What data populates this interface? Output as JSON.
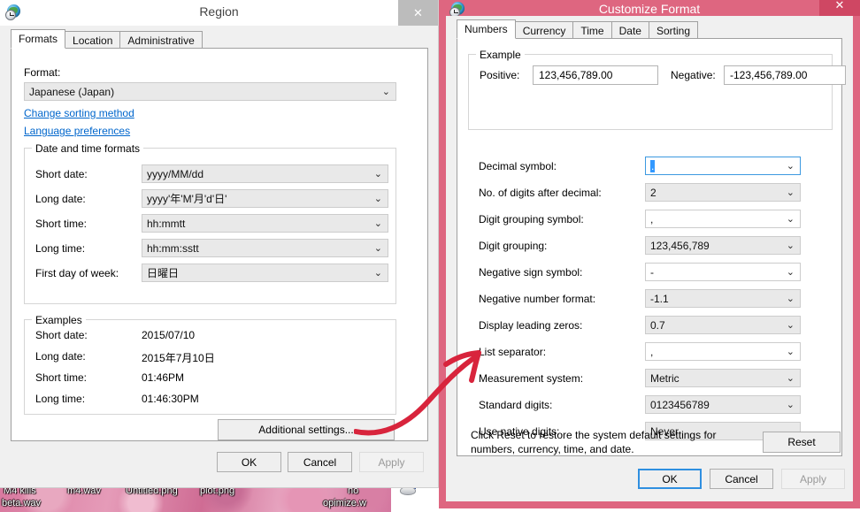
{
  "region_window": {
    "title": "Region",
    "icon": "region-globe-clock-icon",
    "close_label": "✕",
    "tabs": [
      {
        "label": "Formats",
        "active": true
      },
      {
        "label": "Location",
        "active": false
      },
      {
        "label": "Administrative",
        "active": false
      }
    ],
    "format_label": "Format:",
    "format_value": "Japanese (Japan)",
    "links": [
      {
        "label": "Change sorting method"
      },
      {
        "label": "Language preferences"
      }
    ],
    "date_time_group": {
      "legend": "Date and time formats",
      "rows": [
        {
          "label": "Short date:",
          "value": "yyyy/MM/dd"
        },
        {
          "label": "Long date:",
          "value": "yyyy'年'M'月'd'日'"
        },
        {
          "label": "Short time:",
          "value": "hh:mmtt"
        },
        {
          "label": "Long time:",
          "value": "hh:mm:sstt"
        },
        {
          "label": "First day of week:",
          "value": "日曜日"
        }
      ]
    },
    "examples_group": {
      "legend": "Examples",
      "rows": [
        {
          "label": "Short date:",
          "value": "2015/07/10"
        },
        {
          "label": "Long date:",
          "value": "2015年7月10日"
        },
        {
          "label": "Short time:",
          "value": "01:46PM"
        },
        {
          "label": "Long time:",
          "value": "01:46:30PM"
        }
      ]
    },
    "additional_settings_label": "Additional settings...",
    "buttons": [
      {
        "label": "OK",
        "disabled": false
      },
      {
        "label": "Cancel",
        "disabled": false
      },
      {
        "label": "Apply",
        "disabled": true
      }
    ]
  },
  "customize_window": {
    "title": "Customize Format",
    "icon": "customize-globe-clock-icon",
    "close_label": "✕",
    "titlebar_color": "#de6680",
    "close_color": "#cf4763",
    "tabs": [
      {
        "label": "Numbers",
        "active": true
      },
      {
        "label": "Currency",
        "active": false
      },
      {
        "label": "Time",
        "active": false
      },
      {
        "label": "Date",
        "active": false
      },
      {
        "label": "Sorting",
        "active": false
      }
    ],
    "example_group": {
      "legend": "Example",
      "positive_label": "Positive:",
      "positive_value": "123,456,789.00",
      "negative_label": "Negative:",
      "negative_value": "-123,456,789.00"
    },
    "settings": [
      {
        "label": "Decimal symbol:",
        "value": ".",
        "focused": true
      },
      {
        "label": "No. of digits after decimal:",
        "value": "2",
        "focused": false
      },
      {
        "label": "Digit grouping symbol:",
        "value": ",",
        "focused": false
      },
      {
        "label": "Digit grouping:",
        "value": "123,456,789",
        "focused": false
      },
      {
        "label": "Negative sign symbol:",
        "value": "-",
        "focused": false
      },
      {
        "label": "Negative number format:",
        "value": "-1.1",
        "focused": false
      },
      {
        "label": "Display leading zeros:",
        "value": "0.7",
        "focused": false
      },
      {
        "label": "List separator:",
        "value": ",",
        "focused": false
      },
      {
        "label": "Measurement system:",
        "value": "Metric",
        "focused": false
      },
      {
        "label": "Standard digits:",
        "value": "0123456789",
        "focused": false
      },
      {
        "label": "Use native digits:",
        "value": "Never",
        "focused": false
      }
    ],
    "reset_text_line1": "Click Reset to restore the system default settings for",
    "reset_text_line2": "numbers, currency, time, and date.",
    "reset_button_label": "Reset",
    "buttons": [
      {
        "label": "OK",
        "disabled": false,
        "focused": true
      },
      {
        "label": "Cancel",
        "disabled": false,
        "focused": false
      },
      {
        "label": "Apply",
        "disabled": true,
        "focused": false
      }
    ]
  },
  "desktop": {
    "icon_labels": [
      {
        "text": "M4 kills"
      },
      {
        "text": "beta.wav"
      },
      {
        "text": "m4.wav"
      },
      {
        "text": "Untitled.png"
      },
      {
        "text": "plot.png"
      },
      {
        "text": "no"
      },
      {
        "text": "opimize.w"
      }
    ]
  },
  "annotation": {
    "color": "#d8243c",
    "type": "curved-arrow",
    "description": "red hand-drawn arrow from Additional settings button to Measurement system row"
  }
}
